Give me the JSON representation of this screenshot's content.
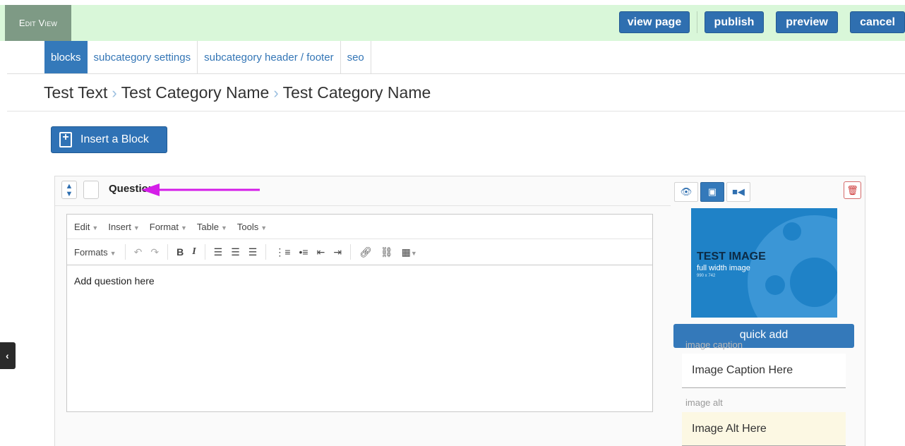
{
  "topbar": {
    "edit_view_label": "Edit View",
    "buttons": {
      "view_page": "view page",
      "publish": "publish",
      "preview": "preview",
      "cancel": "cancel"
    }
  },
  "tabs": [
    {
      "label": "blocks",
      "active": true
    },
    {
      "label": "subcategory settings",
      "active": false
    },
    {
      "label": "subcategory header / footer",
      "active": false
    },
    {
      "label": "seo",
      "active": false
    }
  ],
  "breadcrumb": {
    "items": [
      "Test Text",
      "Test Category Name",
      "Test Category Name"
    ],
    "separator": "›"
  },
  "insert_block": {
    "label": "Insert a Block",
    "icon": "file-plus-icon"
  },
  "block": {
    "title": "Question",
    "editor": {
      "menubar": [
        "Edit",
        "Insert",
        "Format",
        "Table",
        "Tools"
      ],
      "toolbar": {
        "formats_label": "Formats",
        "bold": "B",
        "italic": "I"
      },
      "content": "Add question here"
    },
    "media": {
      "tabs": [
        "eye-icon",
        "image-icon",
        "video-icon"
      ],
      "active_tab": "image-icon",
      "image": {
        "title": "TEST IMAGE",
        "subtitle": "full width image",
        "size_note": "990 x 742"
      },
      "quick_add_label": "quick add",
      "caption_label": "image caption",
      "caption_value": "Image Caption Here",
      "alt_label": "image alt",
      "alt_value": "Image Alt Here"
    }
  },
  "colors": {
    "topbar_bg": "#d9f7d9",
    "primary": "#2f6fb0",
    "annotation_arrow": "#d41ee8",
    "alt_field_bg": "#fcf8e3"
  }
}
